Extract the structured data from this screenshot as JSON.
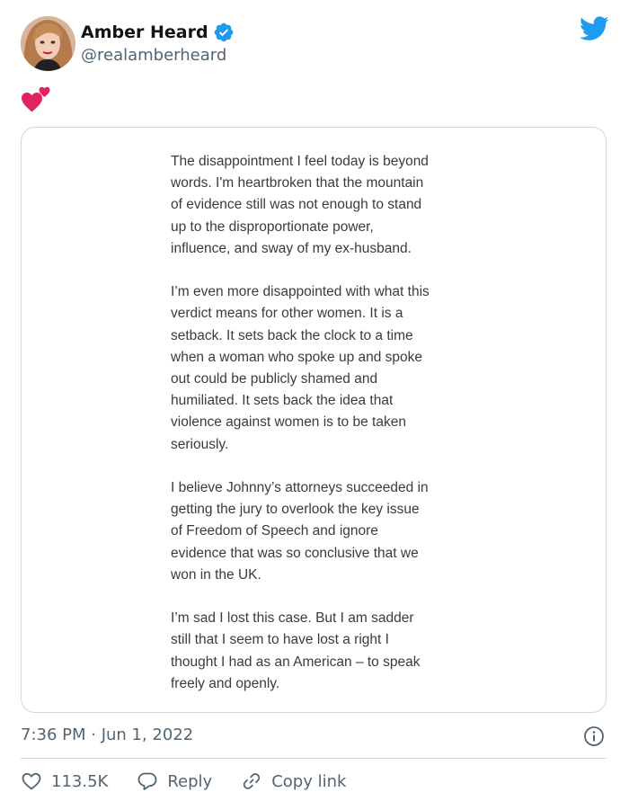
{
  "user": {
    "display_name": "Amber Heard",
    "handle": "@realamberheard",
    "verified": true,
    "verified_icon": "verified-badge-icon",
    "avatar_icon": "avatar"
  },
  "brand": {
    "icon": "twitter-bird-icon",
    "color": "#1d9bf0"
  },
  "tweet": {
    "emoji": "💕",
    "emoji_icon": "two-hearts-icon"
  },
  "statement_image": {
    "paragraphs": [
      "The disappointment I feel today is beyond\nwords. I'm heartbroken that the mountain\nof evidence still was not enough to stand\nup to the disproportionate power,\ninfluence, and sway of my ex-husband.",
      "I’m even more disappointed with what this\nverdict means for other women. It is a\nsetback. It sets back the clock to a time\nwhen a woman who spoke up and spoke\nout could be publicly shamed and\nhumiliated. It sets back the idea that\nviolence against women is to be taken\nseriously.",
      "I believe Johnny’s attorneys succeeded in\ngetting the jury to overlook the key issue\nof Freedom of Speech and ignore\nevidence that was so conclusive that we\nwon in the UK.",
      "I’m sad I lost this case. But I am sadder\nstill that I seem to have lost a right I\nthought I had as an American – to speak\nfreely and openly."
    ]
  },
  "meta": {
    "timestamp": "7:36 PM · Jun 1, 2022",
    "info_icon": "info-icon"
  },
  "actions": {
    "like_count": "113.5K",
    "reply_label": "Reply",
    "copy_link_label": "Copy link",
    "like_icon": "heart-icon",
    "reply_icon": "speech-bubble-icon",
    "copy_link_icon": "link-icon"
  }
}
